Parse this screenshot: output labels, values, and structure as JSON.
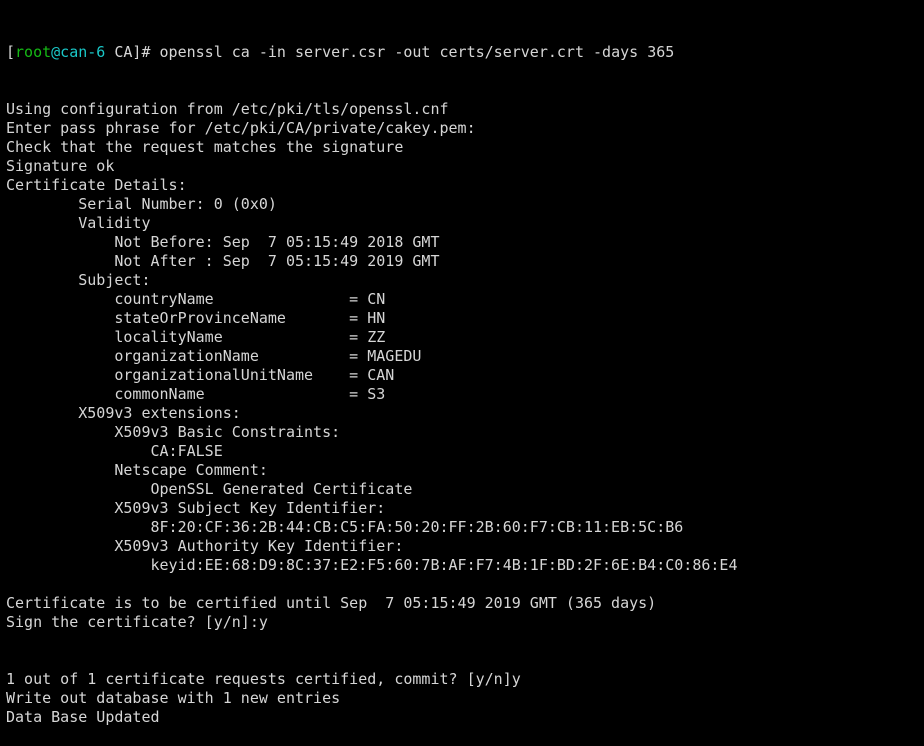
{
  "terminal": {
    "colors": {
      "background": "#000000",
      "foreground": "#d6d6d6",
      "user": "#15b915",
      "host": "#1ac7c7"
    },
    "prompt": {
      "open_bracket": "[",
      "user": "root",
      "at_host": "@can-6",
      "rest": " CA]# ",
      "command": "openssl ca -in server.csr -out certs/server.crt -days 365"
    },
    "lines": [
      "Using configuration from /etc/pki/tls/openssl.cnf",
      "Enter pass phrase for /etc/pki/CA/private/cakey.pem:",
      "Check that the request matches the signature",
      "Signature ok",
      "Certificate Details:",
      "        Serial Number: 0 (0x0)",
      "        Validity",
      "            Not Before: Sep  7 05:15:49 2018 GMT",
      "            Not After : Sep  7 05:15:49 2019 GMT",
      "        Subject:",
      "            countryName               = CN",
      "            stateOrProvinceName       = HN",
      "            localityName              = ZZ",
      "            organizationName          = MAGEDU",
      "            organizationalUnitName    = CAN",
      "            commonName                = S3",
      "        X509v3 extensions:",
      "            X509v3 Basic Constraints:",
      "                CA:FALSE",
      "            Netscape Comment:",
      "                OpenSSL Generated Certificate",
      "            X509v3 Subject Key Identifier:",
      "                8F:20:CF:36:2B:44:CB:C5:FA:50:20:FF:2B:60:F7:CB:11:EB:5C:B6",
      "            X509v3 Authority Key Identifier:",
      "                keyid:EE:68:D9:8C:37:E2:F5:60:7B:AF:F7:4B:1F:BD:2F:6E:B4:C0:86:E4",
      "",
      "Certificate is to be certified until Sep  7 05:15:49 2019 GMT (365 days)",
      "Sign the certificate? [y/n]:y",
      "",
      "",
      "1 out of 1 certificate requests certified, commit? [y/n]y",
      "Write out database with 1 new entries",
      "Data Base Updated"
    ]
  }
}
